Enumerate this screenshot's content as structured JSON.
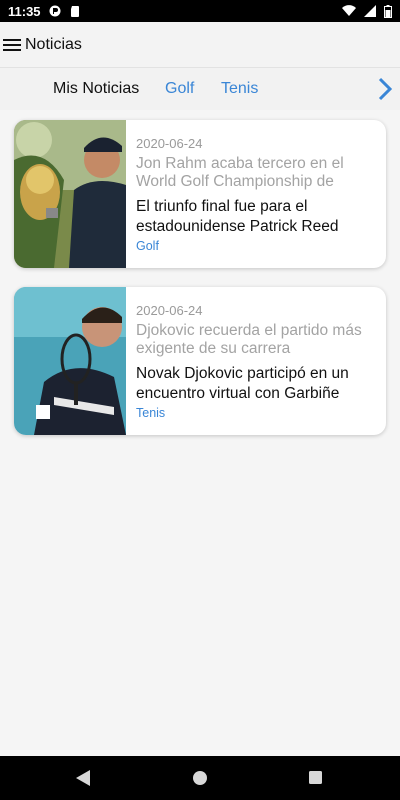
{
  "status_bar": {
    "time": "11:35"
  },
  "app_bar": {
    "title": "Noticias"
  },
  "tabs": [
    {
      "label": "Mis Noticias",
      "active": true
    },
    {
      "label": "Golf",
      "active": false
    },
    {
      "label": "Tenis",
      "active": false
    }
  ],
  "news": [
    {
      "date": "2020-06-24",
      "title": "Jon Rahm acaba tercero en el World Golf Championship de",
      "summary": "El triunfo final fue para el estadounidense Patrick Reed",
      "category": "Golf"
    },
    {
      "date": "2020-06-24",
      "title": "Djokovic recuerda el partido más exigente de su carrera",
      "summary": "Novak Djokovic participó en un encuentro virtual con Garbiñe",
      "category": "Tenis"
    }
  ],
  "colors": {
    "accent": "#3a86d6",
    "background": "#f5f5f5"
  }
}
